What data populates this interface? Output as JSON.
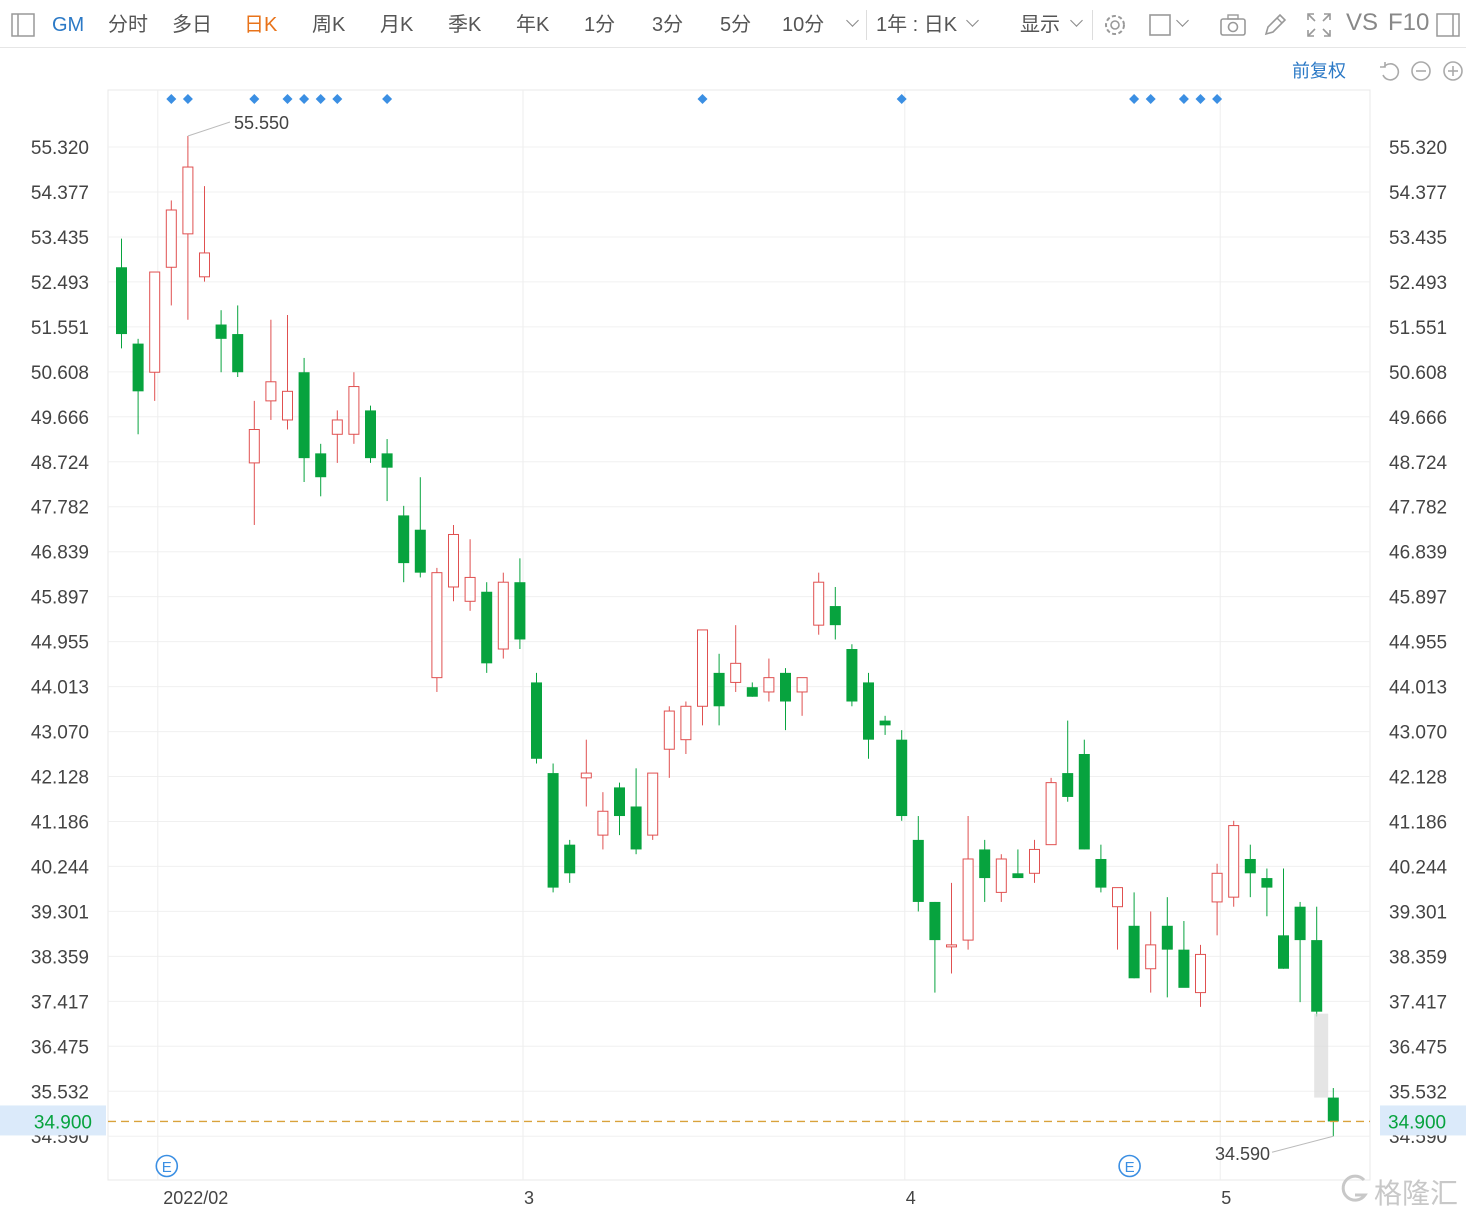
{
  "toolbar": {
    "symbol": "GM",
    "periods": [
      "分时",
      "多日",
      "日K",
      "周K",
      "月K",
      "季K",
      "年K",
      "1分",
      "3分",
      "5分",
      "10分"
    ],
    "active_period": "日K",
    "range": "1年 : 日K",
    "display": "显示",
    "vs": "VS",
    "f10": "F10"
  },
  "adjust_label": "前复权",
  "watermark": "格隆汇",
  "price_axis_labels": [
    "55.320",
    "54.377",
    "53.435",
    "52.493",
    "51.551",
    "50.608",
    "49.666",
    "48.724",
    "47.782",
    "46.839",
    "45.897",
    "44.955",
    "44.013",
    "43.070",
    "42.128",
    "41.186",
    "40.244",
    "39.301",
    "38.359",
    "37.417",
    "36.475",
    "35.532",
    "34.590"
  ],
  "chart_data": {
    "type": "candlestick",
    "x_labels": [
      "2022/02",
      "3",
      "4",
      "5"
    ],
    "x_label_index": [
      3,
      25,
      48,
      67
    ],
    "y_range": [
      34.0,
      56.0
    ],
    "last_price": "34.900",
    "high_annotation": "55.550",
    "low_annotation": "34.590",
    "up_color": "#e05050",
    "down_color": "#07a33e",
    "marker_color": "#3b8fe3",
    "event_label": "E",
    "event_index": [
      3,
      61
    ],
    "markers_index": [
      3,
      4,
      8,
      10,
      11,
      12,
      13,
      16,
      35,
      47,
      61,
      62,
      64,
      65,
      66
    ],
    "candles": [
      {
        "o": 52.8,
        "h": 53.4,
        "l": 51.1,
        "c": 51.4
      },
      {
        "o": 51.2,
        "h": 51.3,
        "l": 49.3,
        "c": 50.2
      },
      {
        "o": 50.6,
        "h": 52.7,
        "l": 50.0,
        "c": 52.7
      },
      {
        "o": 52.8,
        "h": 54.2,
        "l": 52.0,
        "c": 54.0
      },
      {
        "o": 53.5,
        "h": 55.55,
        "l": 51.7,
        "c": 54.9
      },
      {
        "o": 52.6,
        "h": 54.5,
        "l": 52.5,
        "c": 53.1
      },
      {
        "o": 51.6,
        "h": 51.9,
        "l": 50.6,
        "c": 51.3
      },
      {
        "o": 51.4,
        "h": 52.0,
        "l": 50.5,
        "c": 50.6
      },
      {
        "o": 48.7,
        "h": 50.0,
        "l": 47.4,
        "c": 49.4
      },
      {
        "o": 50.0,
        "h": 51.7,
        "l": 49.6,
        "c": 50.4
      },
      {
        "o": 49.6,
        "h": 51.8,
        "l": 49.4,
        "c": 50.2
      },
      {
        "o": 50.6,
        "h": 50.9,
        "l": 48.3,
        "c": 48.8
      },
      {
        "o": 48.9,
        "h": 49.1,
        "l": 48.0,
        "c": 48.4
      },
      {
        "o": 49.3,
        "h": 49.8,
        "l": 48.7,
        "c": 49.6
      },
      {
        "o": 49.3,
        "h": 50.6,
        "l": 49.1,
        "c": 50.3
      },
      {
        "o": 49.8,
        "h": 49.9,
        "l": 48.7,
        "c": 48.8
      },
      {
        "o": 48.9,
        "h": 49.2,
        "l": 47.9,
        "c": 48.6
      },
      {
        "o": 47.6,
        "h": 47.8,
        "l": 46.2,
        "c": 46.6
      },
      {
        "o": 47.3,
        "h": 48.4,
        "l": 46.3,
        "c": 46.4
      },
      {
        "o": 44.2,
        "h": 46.5,
        "l": 43.9,
        "c": 46.4
      },
      {
        "o": 46.1,
        "h": 47.4,
        "l": 45.8,
        "c": 47.2
      },
      {
        "o": 45.8,
        "h": 47.1,
        "l": 45.6,
        "c": 46.3
      },
      {
        "o": 46.0,
        "h": 46.2,
        "l": 44.3,
        "c": 44.5
      },
      {
        "o": 44.8,
        "h": 46.4,
        "l": 44.6,
        "c": 46.2
      },
      {
        "o": 46.2,
        "h": 46.7,
        "l": 44.8,
        "c": 45.0
      },
      {
        "o": 44.1,
        "h": 44.3,
        "l": 42.4,
        "c": 42.5
      },
      {
        "o": 42.2,
        "h": 42.4,
        "l": 39.7,
        "c": 39.8
      },
      {
        "o": 40.7,
        "h": 40.8,
        "l": 39.9,
        "c": 40.1
      },
      {
        "o": 42.1,
        "h": 42.9,
        "l": 41.5,
        "c": 42.2
      },
      {
        "o": 40.9,
        "h": 41.8,
        "l": 40.6,
        "c": 41.4
      },
      {
        "o": 41.9,
        "h": 42.0,
        "l": 40.9,
        "c": 41.3
      },
      {
        "o": 41.5,
        "h": 42.3,
        "l": 40.5,
        "c": 40.6
      },
      {
        "o": 40.9,
        "h": 42.2,
        "l": 40.8,
        "c": 42.2
      },
      {
        "o": 42.7,
        "h": 43.6,
        "l": 42.1,
        "c": 43.5
      },
      {
        "o": 42.9,
        "h": 43.7,
        "l": 42.6,
        "c": 43.6
      },
      {
        "o": 43.6,
        "h": 44.8,
        "l": 43.2,
        "c": 45.2
      },
      {
        "o": 44.3,
        "h": 44.7,
        "l": 43.2,
        "c": 43.6
      },
      {
        "o": 44.1,
        "h": 45.3,
        "l": 43.9,
        "c": 44.5
      },
      {
        "o": 44.0,
        "h": 44.1,
        "l": 43.8,
        "c": 43.8
      },
      {
        "o": 43.9,
        "h": 44.6,
        "l": 43.7,
        "c": 44.2
      },
      {
        "o": 44.3,
        "h": 44.4,
        "l": 43.1,
        "c": 43.7
      },
      {
        "o": 43.9,
        "h": 44.2,
        "l": 43.4,
        "c": 44.2
      },
      {
        "o": 45.3,
        "h": 46.4,
        "l": 45.1,
        "c": 46.2
      },
      {
        "o": 45.7,
        "h": 46.1,
        "l": 45.0,
        "c": 45.3
      },
      {
        "o": 44.8,
        "h": 44.9,
        "l": 43.6,
        "c": 43.7
      },
      {
        "o": 44.1,
        "h": 44.3,
        "l": 42.5,
        "c": 42.9
      },
      {
        "o": 43.3,
        "h": 43.4,
        "l": 43.0,
        "c": 43.2
      },
      {
        "o": 42.9,
        "h": 43.1,
        "l": 41.2,
        "c": 41.3
      },
      {
        "o": 40.8,
        "h": 41.3,
        "l": 39.3,
        "c": 39.5
      },
      {
        "o": 39.5,
        "h": 39.5,
        "l": 37.6,
        "c": 38.7
      },
      {
        "o": 38.6,
        "h": 39.9,
        "l": 38.0,
        "c": 38.6
      },
      {
        "o": 38.7,
        "h": 41.3,
        "l": 38.5,
        "c": 40.4
      },
      {
        "o": 40.6,
        "h": 40.8,
        "l": 39.5,
        "c": 40.0
      },
      {
        "o": 39.7,
        "h": 40.5,
        "l": 39.5,
        "c": 40.4
      },
      {
        "o": 40.1,
        "h": 40.6,
        "l": 40.0,
        "c": 40.0
      },
      {
        "o": 40.1,
        "h": 40.8,
        "l": 39.9,
        "c": 40.6
      },
      {
        "o": 40.7,
        "h": 42.1,
        "l": 40.7,
        "c": 42.0
      },
      {
        "o": 42.2,
        "h": 43.3,
        "l": 41.6,
        "c": 41.7
      },
      {
        "o": 42.6,
        "h": 42.9,
        "l": 40.6,
        "c": 40.6
      },
      {
        "o": 40.4,
        "h": 40.7,
        "l": 39.7,
        "c": 39.8
      },
      {
        "o": 39.4,
        "h": 39.6,
        "l": 38.5,
        "c": 39.8
      },
      {
        "o": 39.0,
        "h": 39.7,
        "l": 37.9,
        "c": 37.9
      },
      {
        "o": 38.1,
        "h": 39.3,
        "l": 37.6,
        "c": 38.6
      },
      {
        "o": 39.0,
        "h": 39.6,
        "l": 37.5,
        "c": 38.5
      },
      {
        "o": 38.5,
        "h": 39.1,
        "l": 38.0,
        "c": 37.7
      },
      {
        "o": 37.6,
        "h": 38.6,
        "l": 37.3,
        "c": 38.4
      },
      {
        "o": 39.5,
        "h": 40.3,
        "l": 38.8,
        "c": 40.1
      },
      {
        "o": 39.6,
        "h": 41.2,
        "l": 39.4,
        "c": 41.1
      },
      {
        "o": 40.4,
        "h": 40.7,
        "l": 39.6,
        "c": 40.1
      },
      {
        "o": 40.0,
        "h": 40.2,
        "l": 39.2,
        "c": 39.8
      },
      {
        "o": 38.8,
        "h": 40.2,
        "l": 38.1,
        "c": 38.1
      },
      {
        "o": 39.4,
        "h": 39.5,
        "l": 37.4,
        "c": 38.7
      },
      {
        "o": 38.7,
        "h": 39.4,
        "l": 37.1,
        "c": 37.2
      },
      {
        "o": 35.4,
        "h": 35.6,
        "l": 34.59,
        "c": 34.9
      }
    ]
  }
}
